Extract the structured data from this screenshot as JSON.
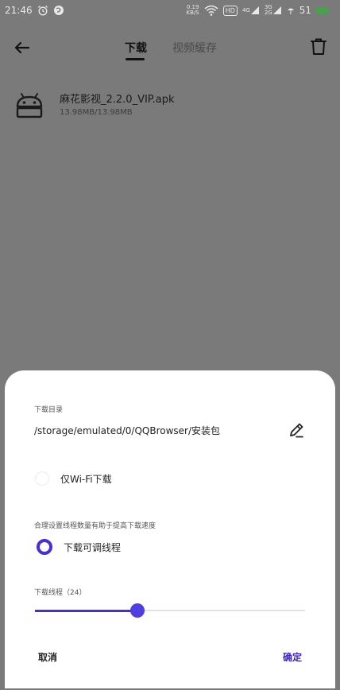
{
  "status_bar": {
    "time": "21:46",
    "net_speed_value": "0.19",
    "net_speed_unit": "KB/S",
    "hd": "HD",
    "sig1_tag": "4G",
    "sig2_tag_top": "3G",
    "sig2_tag_bottom": "2G",
    "battery_level": "51"
  },
  "header": {
    "tabs": [
      "下载",
      "视频缓存"
    ],
    "active_tab_index": 0
  },
  "file": {
    "name": "麻花影视_2.2.0_VIP.apk",
    "size": "13.98MB/13.98MB"
  },
  "sheet": {
    "directory_label": "下载目录",
    "directory_path": "/storage/emulated/0/QQBrowser/安装包",
    "wifi_only_label": "仅Wi-Fi下载",
    "wifi_only_checked": false,
    "tip": "合理设置线程数量有助于提高下载速度",
    "adjustable_threads_label": "下载可调线程",
    "adjustable_threads_checked": true,
    "threads_label": "下载线程（24）",
    "threads_value": 24,
    "slider_fraction": 0.38,
    "cancel": "取消",
    "confirm": "确定"
  },
  "colors": {
    "accent": "#4b2ed0",
    "overlay": "#7a7a7a",
    "battery": "#45a34a"
  }
}
